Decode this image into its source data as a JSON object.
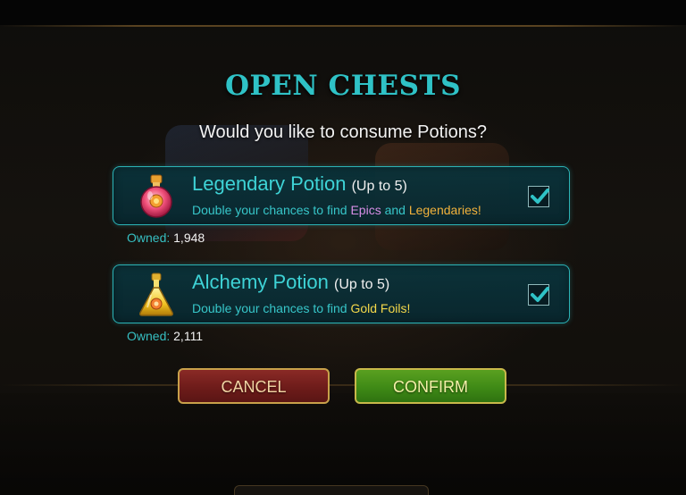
{
  "dialog": {
    "title": "OPEN CHESTS",
    "question": "Would you like to consume Potions?"
  },
  "potions": [
    {
      "name": "Legendary Potion",
      "limit": "(Up to 5)",
      "desc_prefix": "Double your chances to find ",
      "highlight_1": "Epics",
      "desc_middle": " and ",
      "highlight_2": "Legendaries!",
      "owned_label": "Owned:",
      "owned_count": "1,948",
      "checked": true,
      "icon": "legendary-potion-icon"
    },
    {
      "name": "Alchemy Potion",
      "limit": "(Up to 5)",
      "desc_prefix": "Double your chances to find ",
      "highlight_1": "Gold Foils!",
      "owned_label": "Owned:",
      "owned_count": "2,111",
      "checked": true,
      "icon": "alchemy-potion-icon"
    }
  ],
  "buttons": {
    "cancel_label": "CANCEL",
    "confirm_label": "CONFIRM"
  },
  "colors": {
    "title": "#2fc2c6",
    "card_border": "#2bb3b6",
    "epic": "#d78ee6",
    "legendary": "#f2b23c",
    "gold_foil": "#f4d84a",
    "checkmark": "#2fc2c6"
  }
}
